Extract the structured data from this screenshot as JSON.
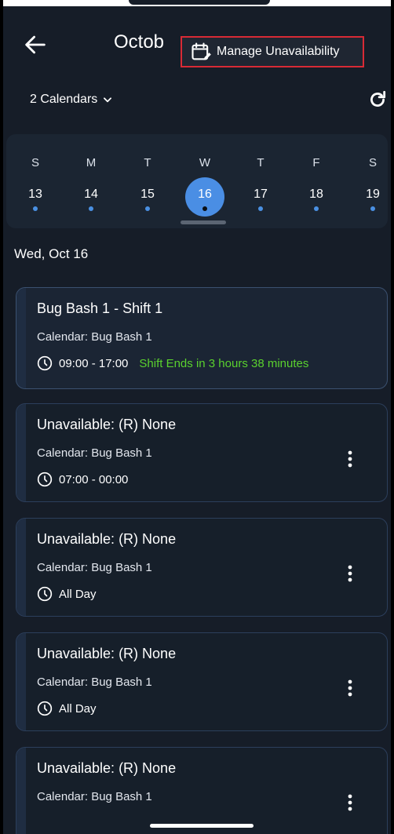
{
  "header": {
    "title": "Octob",
    "menu_item": "Manage Unavailability"
  },
  "calendar_selector": {
    "label": "2 Calendars"
  },
  "week": [
    {
      "dow": "S",
      "num": "13",
      "dot": true,
      "selected": false
    },
    {
      "dow": "M",
      "num": "14",
      "dot": true,
      "selected": false
    },
    {
      "dow": "T",
      "num": "15",
      "dot": true,
      "selected": false
    },
    {
      "dow": "W",
      "num": "16",
      "dot": true,
      "selected": true
    },
    {
      "dow": "T",
      "num": "17",
      "dot": true,
      "selected": false
    },
    {
      "dow": "F",
      "num": "18",
      "dot": true,
      "selected": false
    },
    {
      "dow": "S",
      "num": "19",
      "dot": true,
      "selected": false
    }
  ],
  "date_heading": "Wed, Oct 16",
  "events": [
    {
      "title": "Bug Bash 1 - Shift 1",
      "calendar": "Calendar: Bug Bash 1",
      "time": "09:00 - 17:00",
      "status": "Shift Ends in 3 hours 38 minutes",
      "active": true
    },
    {
      "title": "Unavailable: (R) None",
      "calendar": "Calendar: Bug Bash 1",
      "time": "07:00 - 00:00",
      "status": "",
      "active": false
    },
    {
      "title": "Unavailable: (R) None",
      "calendar": "Calendar: Bug Bash 1",
      "time": "All Day",
      "status": "",
      "active": false
    },
    {
      "title": "Unavailable: (R) None",
      "calendar": "Calendar: Bug Bash 1",
      "time": "All Day",
      "status": "",
      "active": false
    },
    {
      "title": "Unavailable: (R) None",
      "calendar": "Calendar: Bug Bash 1",
      "time": "",
      "status": "",
      "active": false
    }
  ],
  "colors": {
    "accent": "#4a8ee4",
    "shift_status": "#5ad12e",
    "highlight_border": "#d82a35"
  }
}
